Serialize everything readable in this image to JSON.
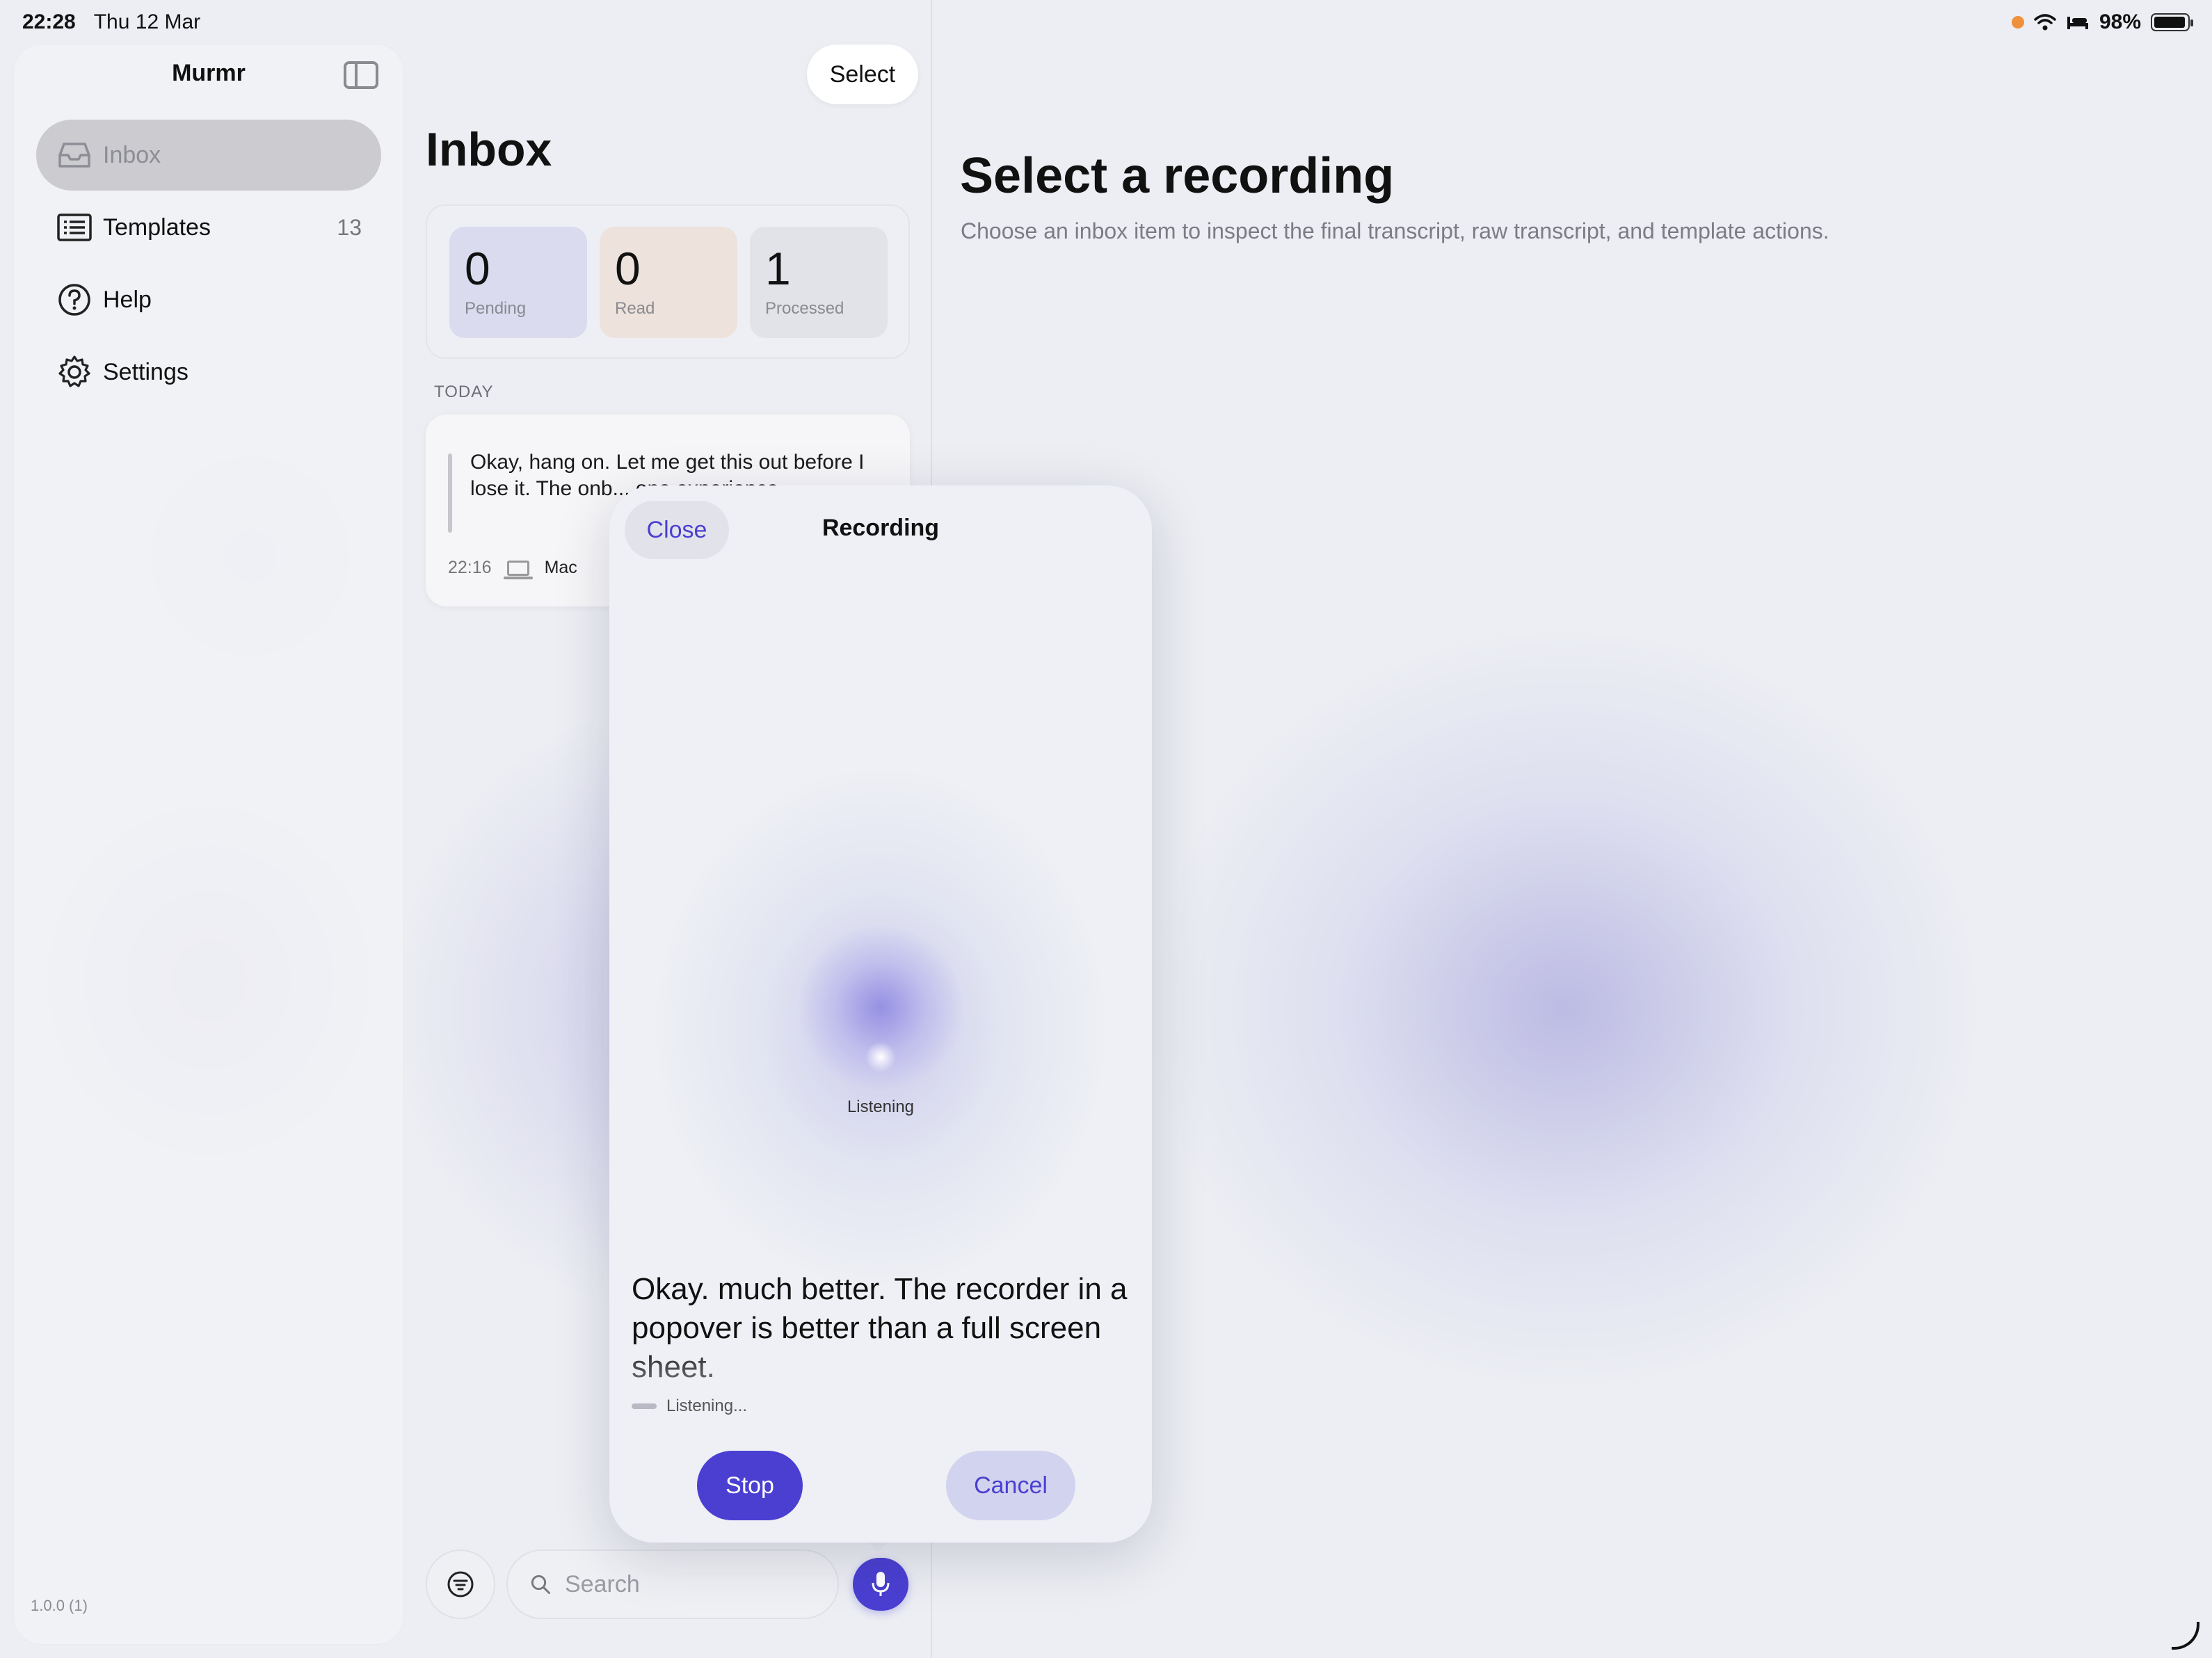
{
  "status_bar": {
    "time": "22:28",
    "date": "Thu 12 Mar",
    "battery": "98%",
    "battery_level": 0.98
  },
  "sidebar": {
    "title": "Murmr",
    "items": [
      {
        "label": "Inbox",
        "icon": "tray-icon",
        "active": true
      },
      {
        "label": "Templates",
        "icon": "list-icon",
        "count": "13"
      },
      {
        "label": "Help",
        "icon": "question-circle-icon"
      },
      {
        "label": "Settings",
        "icon": "gear-icon"
      }
    ],
    "version": "1.0.0 (1)"
  },
  "list": {
    "select_label": "Select",
    "title": "Inbox",
    "stats": [
      {
        "value": "0",
        "label": "Pending"
      },
      {
        "value": "0",
        "label": "Read"
      },
      {
        "value": "1",
        "label": "Processed"
      }
    ],
    "section_label": "TODAY",
    "items": [
      {
        "text": "Okay, hang on. Let me get this out before I lose it. The onb... one experience",
        "time": "22:16",
        "device": "Mac"
      }
    ],
    "search_placeholder": "Search"
  },
  "detail": {
    "title": "Select a recording",
    "subtitle": "Choose an inbox item to inspect the final transcript, raw transcript, and template actions."
  },
  "recorder": {
    "close_label": "Close",
    "title": "Recording",
    "orb_label": "Listening",
    "transcript": "Okay. much better. The recorder in a popover is better than a full screen sheet.",
    "status": "Listening...",
    "stop_label": "Stop",
    "cancel_label": "Cancel"
  },
  "colors": {
    "accent": "#4a3fd1",
    "background": "#eceef3"
  }
}
